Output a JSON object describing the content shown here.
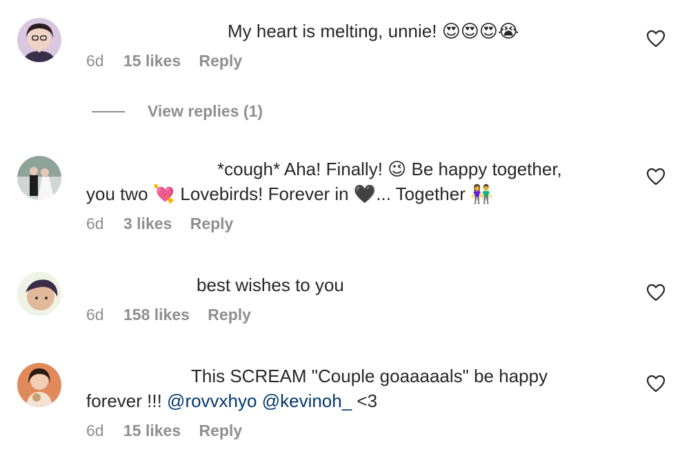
{
  "comments": [
    {
      "text": "My heart is melting, unnie! 😍😍😍😭",
      "time": "6d",
      "likes": "15 likes",
      "reply": "Reply"
    },
    {
      "text_line1": "*cough* Aha! Finally! 😉 Be happy together,",
      "text_line2": "you two 💘 Lovebirds! Forever in 🖤... Together 👫",
      "time": "6d",
      "likes": "3 likes",
      "reply": "Reply"
    },
    {
      "text": "best wishes to you",
      "time": "6d",
      "likes": "158 likes",
      "reply": "Reply"
    },
    {
      "text_line1": "This SCREAM \"Couple goaaaaals\" be happy",
      "text_line2_prefix": "forever !!! ",
      "mention1": "@rovvxhyo",
      "mention2": "@kevinoh_",
      "text_line2_suffix": " <3",
      "time": "6d",
      "likes": "15 likes",
      "reply": "Reply"
    }
  ],
  "view_replies": "View replies (1)",
  "icons": {
    "like": "heart-outline-icon"
  }
}
